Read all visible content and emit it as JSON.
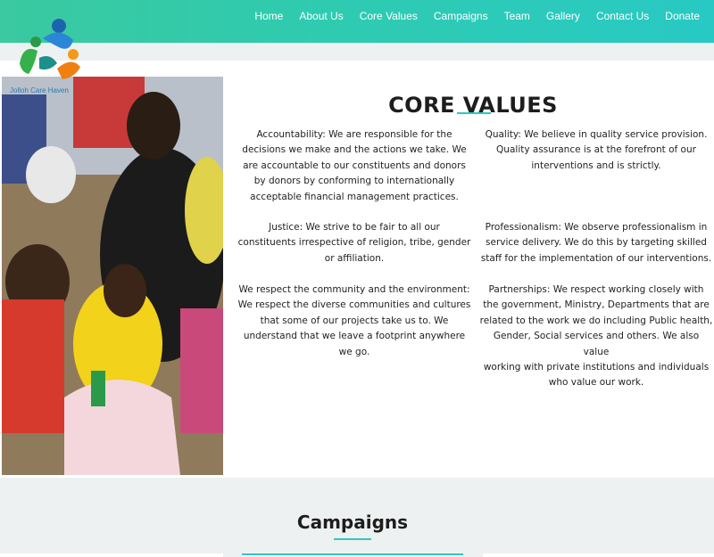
{
  "nav": {
    "items": [
      "Home",
      "About Us",
      "Core Values",
      "Campaigns",
      "Team",
      "Gallery",
      "Contact Us",
      "Donate"
    ]
  },
  "logo": {
    "icon": "people-circle-logo-icon",
    "text": "Jolloh Care Haven"
  },
  "hero_image": {
    "icon": "children-group-photo"
  },
  "core_values": {
    "title": "CORE VALUES",
    "left": [
      [
        "Accountability: We are responsible for the",
        "decisions we make and the actions we take. We",
        "are accountable to our constituents and donors",
        "by donors by conforming to internationally",
        "acceptable financial management practices."
      ],
      [
        "Justice: We strive to be fair to all our",
        "constituents irrespective of religion, tribe, gender",
        "or affiliation."
      ],
      [
        "We respect the community and the environment:",
        "We respect the diverse communities and cultures",
        "that some of our projects take us to. We",
        "understand that we leave a footprint anywhere",
        "we go."
      ]
    ],
    "right": [
      [
        "Quality: We believe in quality service provision.",
        "Quality assurance is at the forefront of our",
        "interventions and is strictly."
      ],
      [
        "Professionalism: We observe professionalism in",
        "service delivery. We do this by targeting skilled",
        "staff for the implementation of our interventions."
      ],
      [
        "Partnerships: We respect working closely with",
        "the government, Ministry, Departments that are",
        "related to the work we do including Public health,",
        "Gender, Social services and others. We also value",
        "working with private institutions and individuals",
        "who value our work."
      ]
    ]
  },
  "campaigns": {
    "title": "Campaigns"
  },
  "colors": {
    "header_start": "#3ac9a0",
    "header_end": "#28c9c4",
    "accent": "#2fc8c0"
  }
}
